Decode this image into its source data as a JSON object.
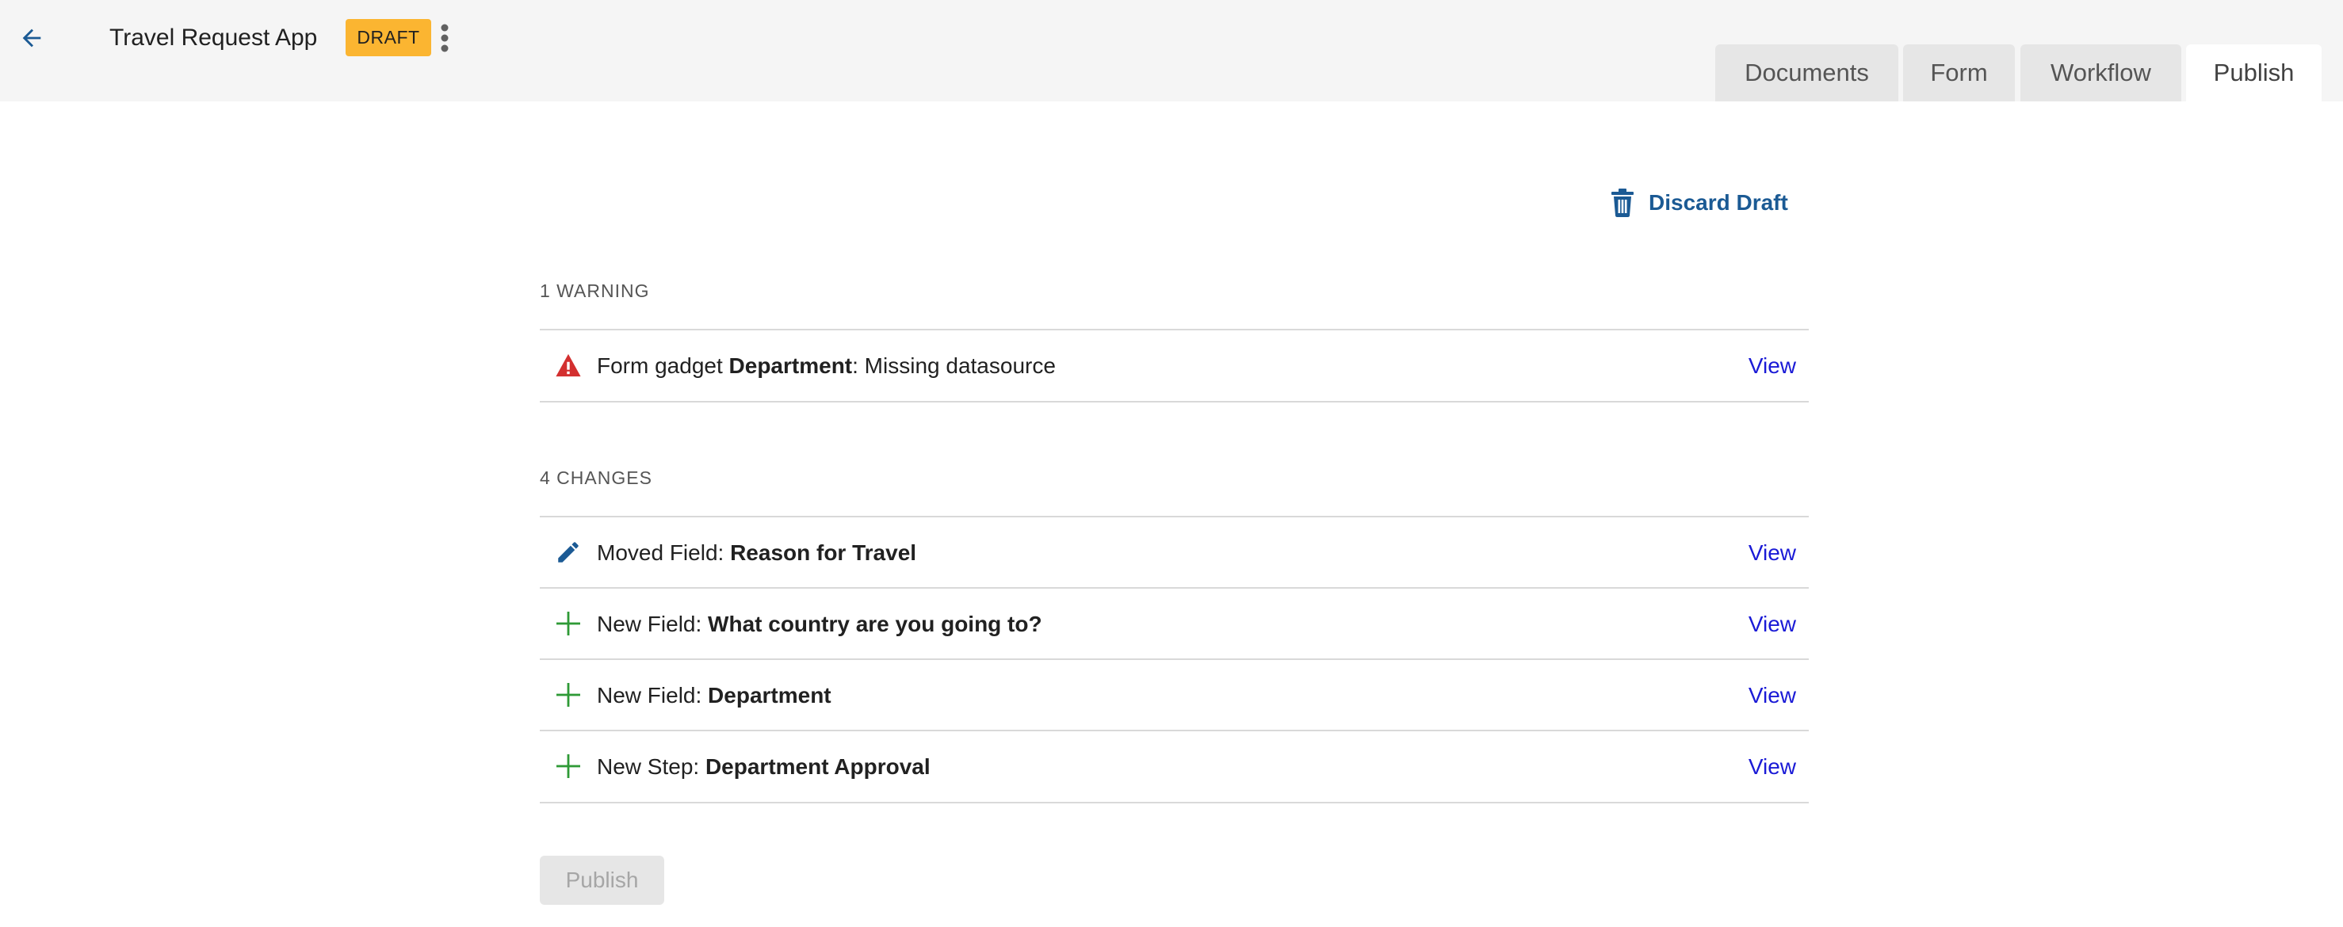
{
  "header": {
    "app_title": "Travel Request App",
    "status_badge": "DRAFT",
    "tabs": [
      {
        "label": "Documents",
        "active": false
      },
      {
        "label": "Form",
        "active": false
      },
      {
        "label": "Workflow",
        "active": false
      },
      {
        "label": "Publish",
        "active": true
      }
    ]
  },
  "actions": {
    "discard_label": "Discard Draft",
    "publish_label": "Publish",
    "publish_enabled": false
  },
  "warnings": {
    "heading": "1 WARNING",
    "items": [
      {
        "icon": "warning-icon",
        "prefix": "Form gadget ",
        "bold": "Department",
        "suffix": ": Missing datasource",
        "link": "View"
      }
    ]
  },
  "changes": {
    "heading": "4 CHANGES",
    "items": [
      {
        "icon": "pencil-icon",
        "prefix": "Moved Field: ",
        "bold": "Reason for Travel",
        "suffix": "",
        "link": "View"
      },
      {
        "icon": "plus-icon",
        "prefix": "New Field: ",
        "bold": "What country are you going to?",
        "suffix": "",
        "link": "View"
      },
      {
        "icon": "plus-icon",
        "prefix": "New Field: ",
        "bold": "Department",
        "suffix": "",
        "link": "View"
      },
      {
        "icon": "plus-icon",
        "prefix": "New Step: ",
        "bold": "Department Approval",
        "suffix": "",
        "link": "View"
      }
    ]
  },
  "colors": {
    "accent": "#1b5a94",
    "link": "#1a1ad6",
    "badge": "#fbb531",
    "warning": "#d32f2f",
    "added": "#2e9a36"
  }
}
